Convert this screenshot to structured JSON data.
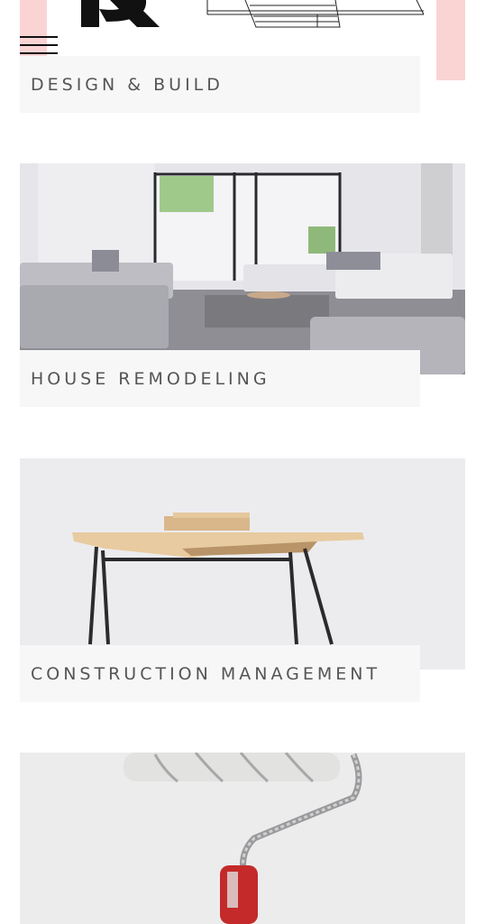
{
  "menu": {
    "icon": "hamburger-menu-icon"
  },
  "services": [
    {
      "title": "DESIGN & BUILD"
    },
    {
      "title": "HOUSE REMODELING"
    },
    {
      "title": "CONSTRUCTION MANAGEMENT"
    },
    {
      "title": ""
    }
  ],
  "colors": {
    "caption_bg": "#f7f7f7",
    "caption_text": "#555555",
    "accent_pink": "#fad4d3"
  }
}
